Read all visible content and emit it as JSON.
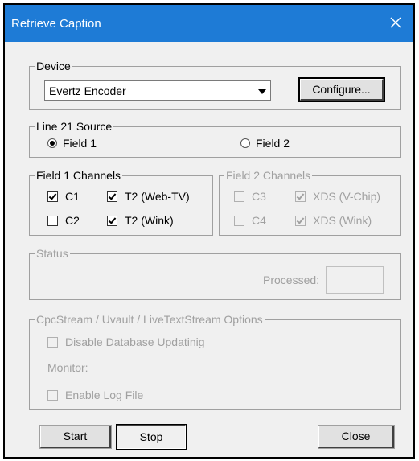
{
  "window": {
    "title": "Retrieve Caption"
  },
  "device": {
    "group_label": "Device",
    "selected": "Evertz Encoder",
    "configure_label": "Configure..."
  },
  "line21": {
    "group_label": "Line 21 Source",
    "field1": {
      "label": "Field 1",
      "selected": true
    },
    "field2": {
      "label": "Field 2",
      "selected": false
    }
  },
  "field1_channels": {
    "group_label": "Field 1 Channels",
    "items": [
      {
        "label": "C1",
        "checked": true
      },
      {
        "label": "T2 (Web-TV)",
        "checked": true
      },
      {
        "label": "C2",
        "checked": false
      },
      {
        "label": "T2 (Wink)",
        "checked": true
      }
    ]
  },
  "field2_channels": {
    "group_label": "Field 2 Channels",
    "items": [
      {
        "label": "C3",
        "checked": false
      },
      {
        "label": "XDS  (V-Chip)",
        "checked": true
      },
      {
        "label": "C4",
        "checked": false
      },
      {
        "label": "XDS  (Wink)",
        "checked": true
      }
    ]
  },
  "status": {
    "group_label": "Status",
    "processed_label": "Processed:",
    "processed_value": ""
  },
  "options": {
    "group_label": "CpcStream / Uvault / LiveTextStream Options",
    "disable_db_label": "Disable Database Updatinig",
    "monitor_label": "Monitor:",
    "enable_log_label": "Enable Log File"
  },
  "buttons": {
    "start": "Start",
    "stop": "Stop",
    "close": "Close"
  }
}
